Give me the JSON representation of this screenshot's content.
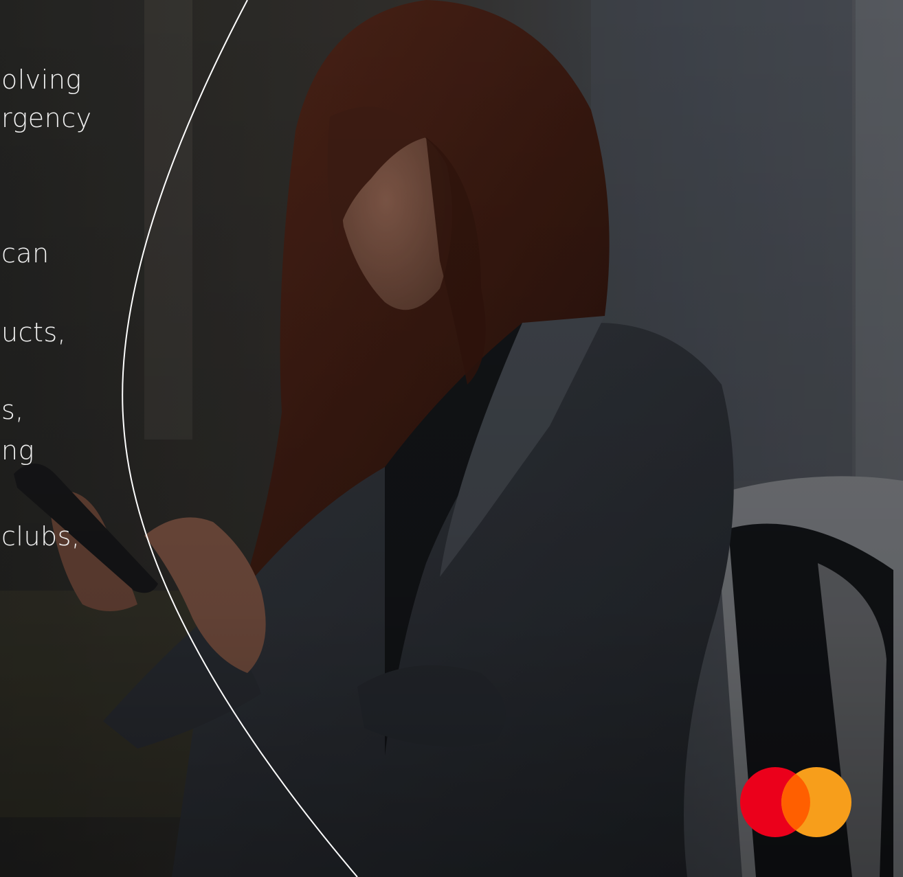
{
  "fragments": {
    "l1": "olving",
    "l2": "rgency",
    "l3": "can",
    "l4": "ucts,",
    "l5": "s,",
    "l6": "ng",
    "l7": "clubs,"
  },
  "logo": {
    "name": "mastercard-logo",
    "red": "#EB001B",
    "orange": "#F79E1B",
    "overlap": "#FF5F00"
  }
}
